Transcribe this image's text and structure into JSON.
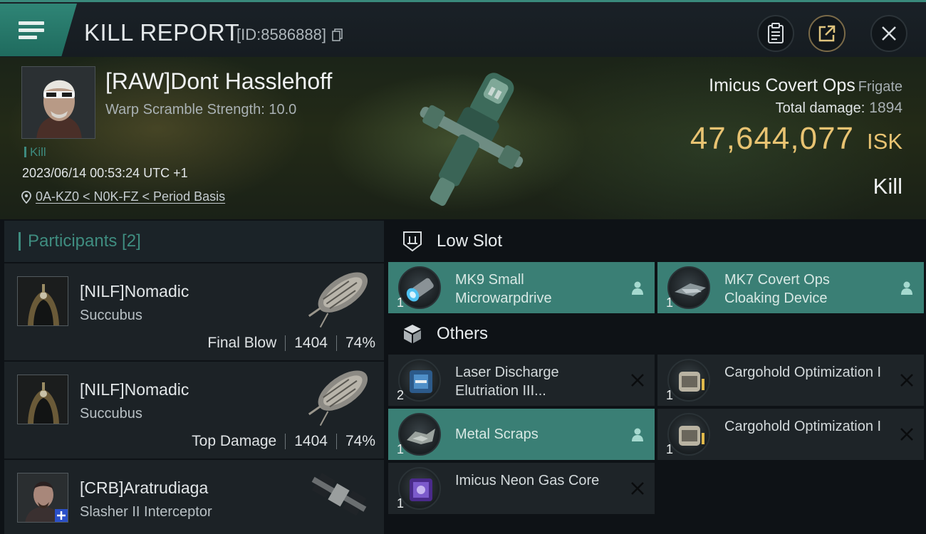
{
  "header": {
    "title": "KILL REPORT",
    "report_id": "[ID:8586888]",
    "buttons": [
      "clipboard-icon",
      "share-icon",
      "close-icon"
    ]
  },
  "victim": {
    "name": "[RAW]Dont Hasslehoff",
    "warp_scramble": "Warp Scramble Strength: 10.0",
    "tag": "Kill",
    "datetime": "2023/06/14 00:53:24 UTC +1",
    "location": "0A-KZ0 < N0K-FZ < Period Basis"
  },
  "ship": {
    "name": "Imicus Covert Ops",
    "class": "Frigate",
    "damage_label": "Total damage:",
    "damage_value": "1894",
    "isk_amount": "47,644,077",
    "isk_unit": "ISK",
    "result": "Kill"
  },
  "participants": {
    "title": "Participants [2]",
    "rows": [
      {
        "name": "[NILF]Nomadic",
        "ship": "Succubus",
        "role": "Final Blow",
        "damage": "1404",
        "percent": "74%"
      },
      {
        "name": "[NILF]Nomadic",
        "ship": "Succubus",
        "role": "Top Damage",
        "damage": "1404",
        "percent": "74%"
      },
      {
        "name": "[CRB]Aratrudiaga",
        "ship": "Slasher II Interceptor"
      }
    ]
  },
  "fitting": {
    "low_slot": {
      "title": "Low Slot",
      "items": [
        {
          "name": "MK9 Small Microwarpdrive",
          "qty": "1",
          "state": "dropped"
        },
        {
          "name": "MK7 Covert Ops Cloaking Device",
          "qty": "1",
          "state": "dropped"
        }
      ]
    },
    "others": {
      "title": "Others",
      "items": [
        {
          "name": "Laser Discharge Elutriation III...",
          "qty": "2",
          "state": "destroyed"
        },
        {
          "name": "Cargohold Optimization I",
          "qty": "1",
          "state": "destroyed"
        },
        {
          "name": "Metal Scraps",
          "qty": "1",
          "state": "dropped"
        },
        {
          "name": "Cargohold Optimization I",
          "qty": "1",
          "state": "destroyed"
        },
        {
          "name": "Imicus Neon Gas Core",
          "qty": "1",
          "state": "destroyed"
        }
      ]
    }
  },
  "colors": {
    "accent": "#3a7f75",
    "isk": "#e8c372",
    "background": "#0e1216"
  }
}
